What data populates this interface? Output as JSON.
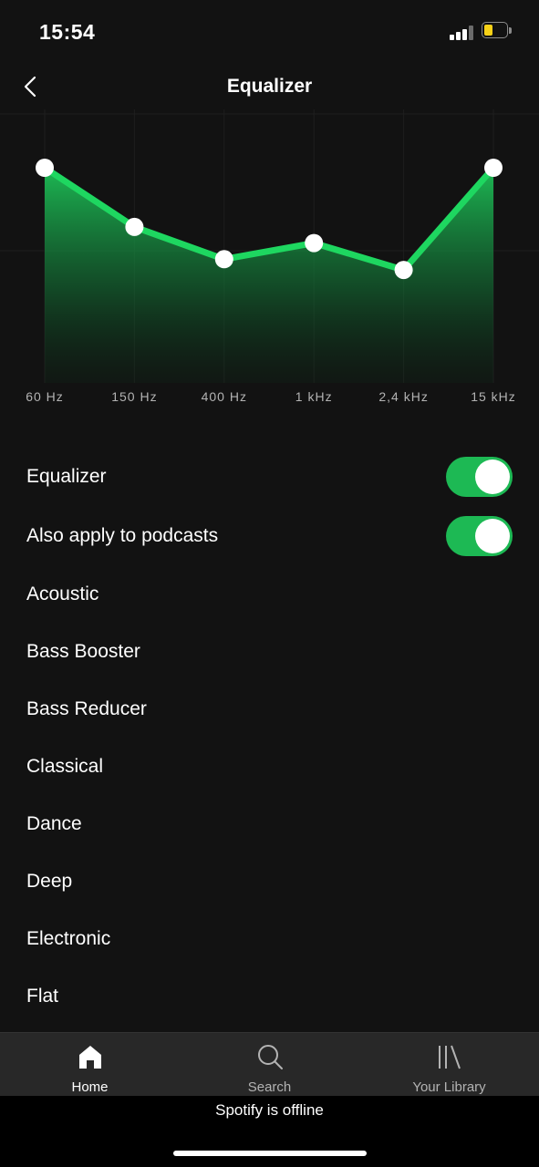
{
  "status_bar": {
    "time": "15:54",
    "battery_color": "#f7d117"
  },
  "nav": {
    "title": "Equalizer",
    "back_icon": "chevron-left-icon"
  },
  "equalizer": {
    "bands": [
      {
        "label": "60 Hz",
        "level": 0.8
      },
      {
        "label": "150 Hz",
        "level": 0.58
      },
      {
        "label": "400 Hz",
        "level": 0.46
      },
      {
        "label": "1 kHz",
        "level": 0.52
      },
      {
        "label": "2,4 kHz",
        "level": 0.42
      },
      {
        "label": "15 kHz",
        "level": 0.8
      }
    ],
    "accent": "#1ed760"
  },
  "settings": {
    "equalizer_label": "Equalizer",
    "equalizer_on": true,
    "podcasts_label": "Also apply to podcasts",
    "podcasts_on": true
  },
  "presets": [
    "Acoustic",
    "Bass Booster",
    "Bass Reducer",
    "Classical",
    "Dance",
    "Deep",
    "Electronic",
    "Flat"
  ],
  "tab_bar": {
    "tabs": [
      {
        "label": "Home",
        "icon": "home-icon",
        "active": true
      },
      {
        "label": "Search",
        "icon": "search-icon",
        "active": false
      },
      {
        "label": "Your Library",
        "icon": "library-icon",
        "active": false
      }
    ]
  },
  "offline": {
    "text": "Spotify is offline"
  }
}
